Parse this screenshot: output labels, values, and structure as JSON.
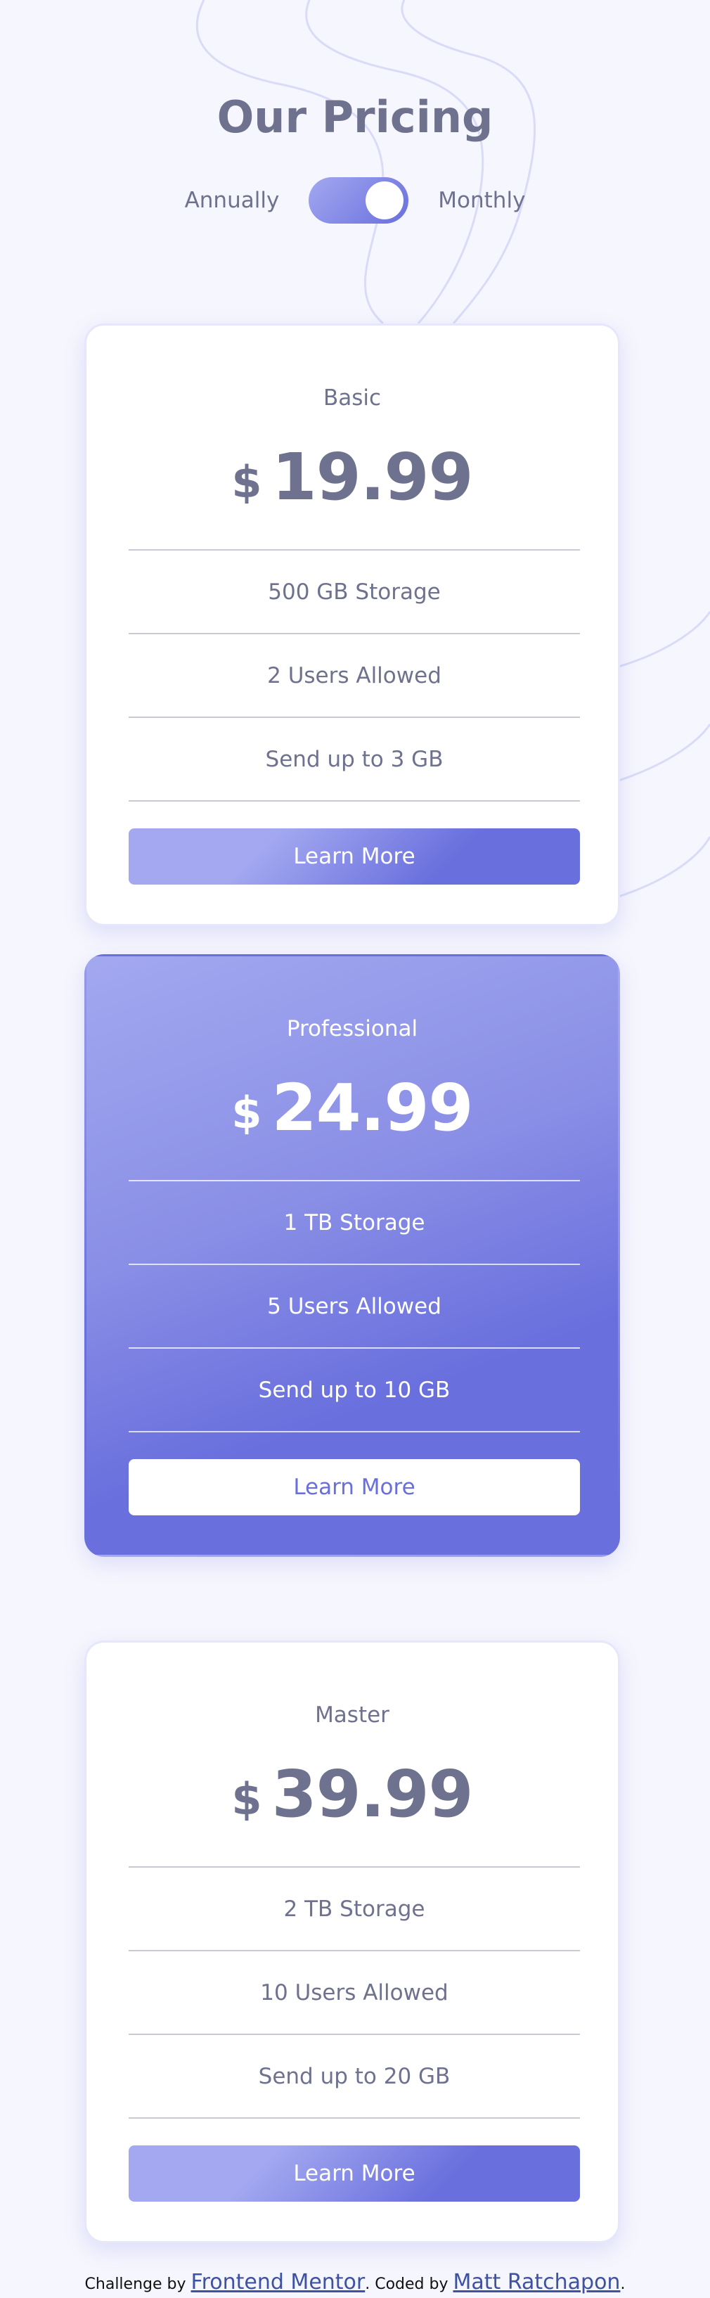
{
  "header": {
    "title": "Our Pricing"
  },
  "toggle": {
    "left_label": "Annually",
    "right_label": "Monthly",
    "state": "monthly"
  },
  "plans": [
    {
      "name": "Basic",
      "currency": "$",
      "price": "19.99",
      "features": [
        "500 GB Storage",
        "2 Users Allowed",
        "Send up to 3 GB"
      ],
      "button_label": "Learn More",
      "featured": false
    },
    {
      "name": "Professional",
      "currency": "$",
      "price": "24.99",
      "features": [
        "1 TB Storage",
        "5 Users Allowed",
        "Send up to 10 GB"
      ],
      "button_label": "Learn More",
      "featured": true
    },
    {
      "name": "Master",
      "currency": "$",
      "price": "39.99",
      "features": [
        "2 TB Storage",
        "10 Users Allowed",
        "Send up to 20 GB"
      ],
      "button_label": "Learn More",
      "featured": false
    }
  ],
  "footer": {
    "prefix": "Challenge by ",
    "link1": "Frontend Mentor",
    "middle": ". Coded by ",
    "link2": "Matt Ratchapon",
    "suffix": "."
  },
  "colors": {
    "background": "#f6f6fe",
    "text": "#6e728e",
    "accent_light": "#a3a8f0",
    "accent_dark": "#696fdd",
    "link": "#3e52a3"
  }
}
